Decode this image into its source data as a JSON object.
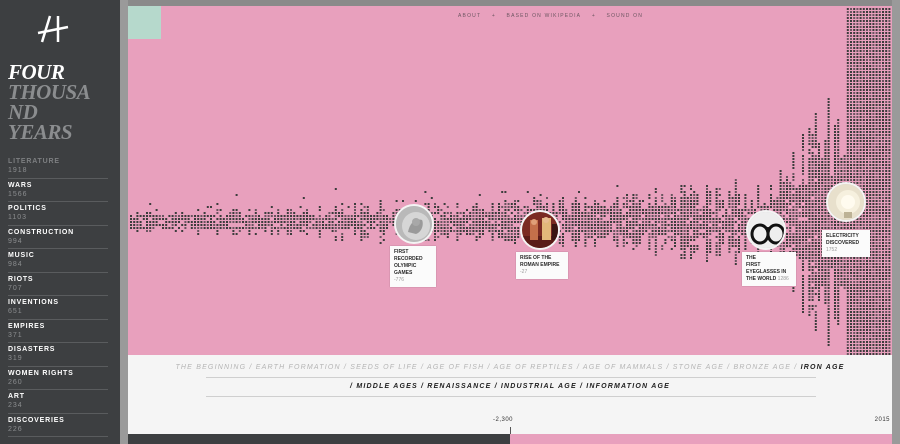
{
  "app": {
    "title_line1": "FOUR",
    "title_line2": "THOUSA",
    "title_line3": "ND",
    "title_line4": "YEARS"
  },
  "categories": [
    {
      "name": "LITERATURE",
      "count": "1918",
      "dim": true
    },
    {
      "name": "WARS",
      "count": "1566"
    },
    {
      "name": "POLITICS",
      "count": "1103"
    },
    {
      "name": "CONSTRUCTION",
      "count": "994"
    },
    {
      "name": "MUSIC",
      "count": "984"
    },
    {
      "name": "RIOTS",
      "count": "707"
    },
    {
      "name": "INVENTIONS",
      "count": "651"
    },
    {
      "name": "EMPIRES",
      "count": "371"
    },
    {
      "name": "DISASTERS",
      "count": "319"
    },
    {
      "name": "WOMEN RIGHTS",
      "count": "260"
    },
    {
      "name": "ART",
      "count": "234"
    },
    {
      "name": "DISCOVERIES",
      "count": "226"
    }
  ],
  "topnav": {
    "about": "ABOUT",
    "sep1": "+",
    "based_on": "BASED ON WIKIPEDIA",
    "sep2": "+",
    "sound": "SOUND ON"
  },
  "events": [
    {
      "title_line1": "FIRST RECORDED",
      "title_line2": "OLYMPIC GAMES",
      "year": "-776",
      "image": "olympic-coin"
    },
    {
      "title_line1": "RISE OF THE",
      "title_line2": "ROMAN EMPIRE",
      "year": "-27",
      "image": "roman-painting"
    },
    {
      "title_line1": "THE",
      "title_line2": "FIRST EYEGLASSES IN",
      "title_line3": "THE WORLD",
      "year": "1286",
      "image": "eyeglasses"
    },
    {
      "title_line1": "ELECTRICITY",
      "title_line2": "DISCOVERED",
      "year": "1752",
      "image": "lightbulb"
    }
  ],
  "ages": {
    "line1": [
      "THE BEGINNING /",
      "EARTH FORMATION /",
      "SEEDS OF LIFE /",
      "AGE OF FISH /",
      "AGE OF REPTILES /",
      "AGE OF MAMMALS /",
      "STONE AGE /",
      "BRONZE AGE /"
    ],
    "current": "IRON AGE",
    "line2": "/ MIDDLE AGES / RENAISSANCE / INDUSTRIAL AGE / INFORMATION AGE"
  },
  "timeline": {
    "start": "-2,300",
    "end": "2015"
  },
  "colors": {
    "sidebar": "#3d3f41",
    "pink": "#e8a0bd",
    "mint": "#b6d9cc",
    "dot": "#3c3c3c"
  }
}
